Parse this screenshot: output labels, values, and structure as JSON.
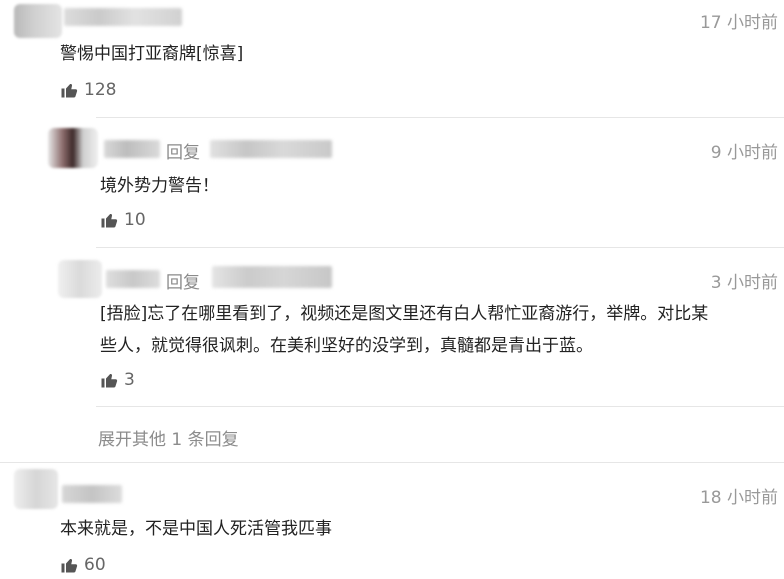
{
  "colors": {
    "text": "#222222",
    "muted": "#999999",
    "like": "#666666",
    "divider": "#e6e6e6"
  },
  "comments": [
    {
      "time": "17 小时前",
      "content": "警惕中国打亚裔牌[惊喜]",
      "likes": "128"
    },
    {
      "reply_label": "回复",
      "time": "9 小时前",
      "content": "境外势力警告！",
      "likes": "10"
    },
    {
      "reply_label": "回复",
      "time": "3 小时前",
      "content_line1": "[捂脸]忘了在哪里看到了，视频还是图文里还有白人帮忙亚裔游行，举牌。对比某",
      "content_line2": "些人，就觉得很讽刺。在美利坚好的没学到，真髓都是青出于蓝。",
      "likes": "3"
    },
    {
      "time": "18 小时前",
      "content": "本来就是，不是中国人死活管我匹事",
      "likes": "60"
    }
  ],
  "expand_replies": "展开其他 1 条回复",
  "icons": {
    "like": "thumbs-up-icon"
  }
}
